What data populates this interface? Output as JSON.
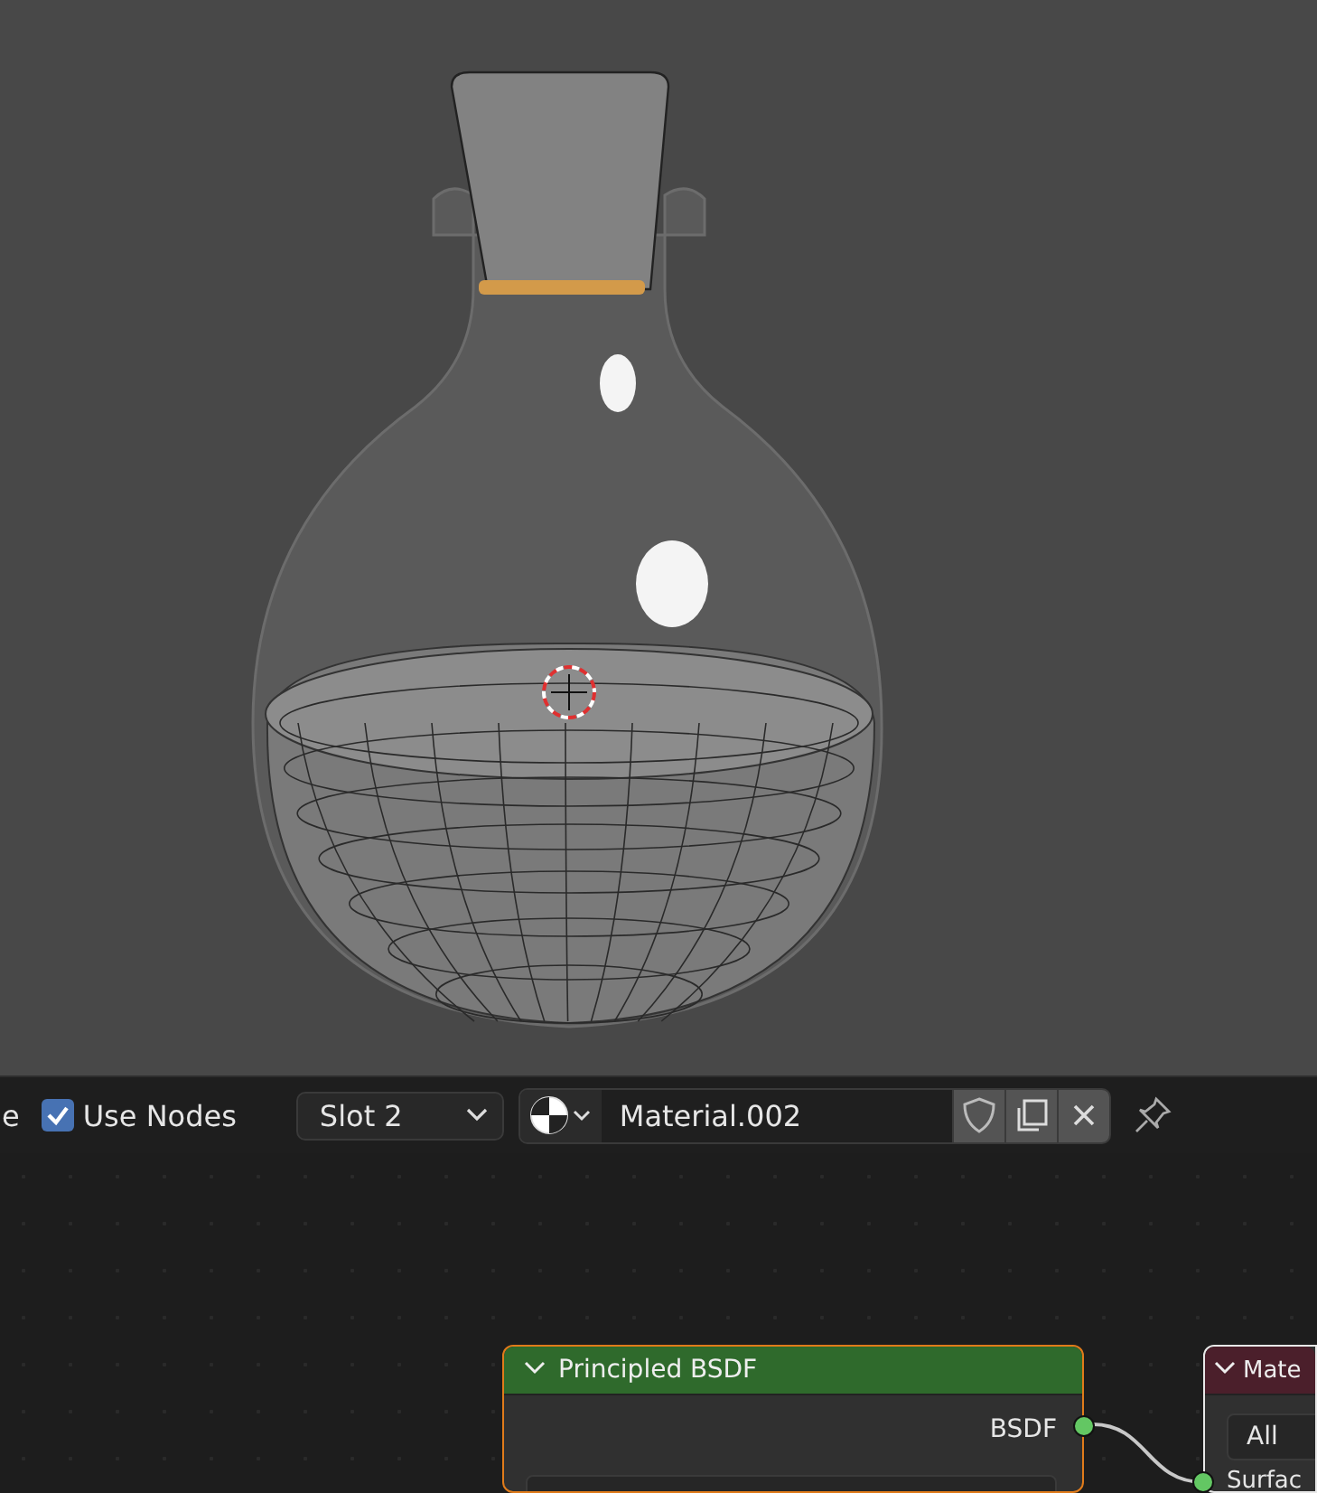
{
  "header": {
    "cut_label": "e",
    "use_nodes": {
      "label": "Use Nodes",
      "checked": true
    },
    "slot": "Slot 2",
    "material": "Material.002"
  },
  "nodes": [
    {
      "kind": "bsdf",
      "title": "Principled BSDF",
      "expanded": true,
      "selected": true,
      "outputs": [
        "BSDF"
      ]
    },
    {
      "kind": "output",
      "title": "Mate",
      "expanded": true,
      "selected": false,
      "target": "All",
      "inputs": [
        "Surfac"
      ]
    }
  ]
}
